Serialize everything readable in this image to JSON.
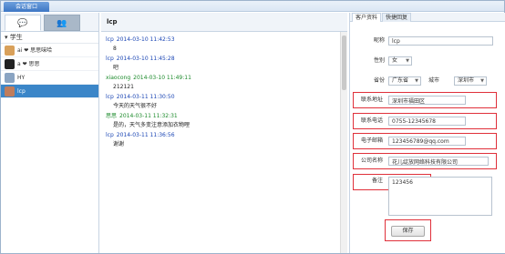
{
  "window": {
    "title": "会话窗口"
  },
  "left": {
    "group": "学生",
    "contacts": [
      {
        "name": "ai ❤ 思思味哈",
        "avatar_color": "#d8a05a"
      },
      {
        "name": "a ❤ 思思",
        "avatar_color": "#222222"
      },
      {
        "name": "HY",
        "avatar_color": "#8aa4c2"
      },
      {
        "name": "lcp",
        "avatar_color": "#c07d5c"
      }
    ]
  },
  "chat": {
    "title": "lcp",
    "messages": [
      {
        "sender": "lcp",
        "time": "2014-03-10 11:42:53",
        "text": "8",
        "color": "blue"
      },
      {
        "sender": "lcp",
        "time": "2014-03-10 11:45:28",
        "text": "吧",
        "color": "blue"
      },
      {
        "sender": "xiaocong",
        "time": "2014-03-10 11:49:11",
        "text": "212121",
        "color": "green"
      },
      {
        "sender": "lcp",
        "time": "2014-03-11 11:30:50",
        "text": "今天的天气很不好",
        "color": "blue"
      },
      {
        "sender": "思思",
        "time": "2014-03-11 11:32:31",
        "text": "是的，天气多变注意添加衣物哩",
        "color": "green"
      },
      {
        "sender": "lcp",
        "time": "2014-03-11 11:36:56",
        "text": "谢谢",
        "color": "blue"
      }
    ]
  },
  "profile": {
    "tabs": [
      "客户资料",
      "快捷回复"
    ],
    "nickname_label": "昵称",
    "nickname": "lcp",
    "gender_label": "性别",
    "gender": "女",
    "province_label": "省份",
    "province": "广东省",
    "city_label": "城市",
    "city": "深圳市",
    "address_label": "联系地址",
    "address": "深圳市福田区",
    "phone_label": "联系电话",
    "phone": "0755-12345678",
    "email_label": "电子邮箱",
    "email": "123456789@qq.com",
    "company_label": "公司名称",
    "company": "花儿绽放网络科技有限公司",
    "notes_label": "备注",
    "notes": "123456",
    "save_label": "保存"
  },
  "colors": {
    "highlight_box": "#e0303a",
    "selected_contact": "#3b86c8"
  }
}
